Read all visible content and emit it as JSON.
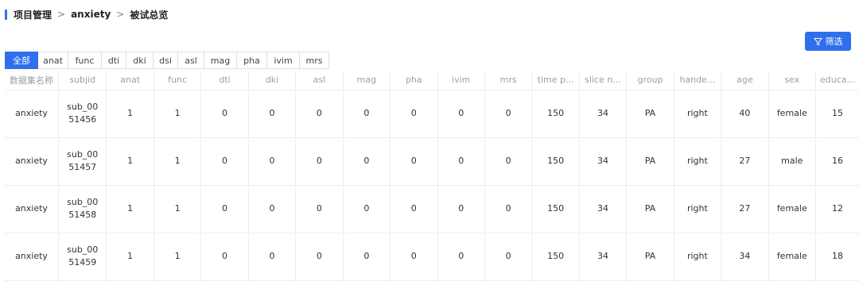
{
  "breadcrumb": {
    "items": [
      "项目管理",
      "anxiety",
      "被试总览"
    ]
  },
  "filter_button": {
    "label": "筛选",
    "icon": "filter-icon"
  },
  "tabs": [
    {
      "label": "全部",
      "active": true
    },
    {
      "label": "anat"
    },
    {
      "label": "func"
    },
    {
      "label": "dti"
    },
    {
      "label": "dki"
    },
    {
      "label": "dsi"
    },
    {
      "label": "asl"
    },
    {
      "label": "mag"
    },
    {
      "label": "pha"
    },
    {
      "label": "ivim"
    },
    {
      "label": "mrs"
    }
  ],
  "table": {
    "headers": [
      "数据集名称",
      "subjid",
      "anat",
      "func",
      "dti",
      "dki",
      "asl",
      "mag",
      "pha",
      "ivim",
      "mrs",
      "time p...",
      "slice n...",
      "group",
      "hande...",
      "age",
      "sex",
      "educa..."
    ],
    "rows": [
      [
        "anxiety",
        "sub_0051456",
        "1",
        "1",
        "0",
        "0",
        "0",
        "0",
        "0",
        "0",
        "0",
        "150",
        "34",
        "PA",
        "right",
        "40",
        "female",
        "15"
      ],
      [
        "anxiety",
        "sub_0051457",
        "1",
        "1",
        "0",
        "0",
        "0",
        "0",
        "0",
        "0",
        "0",
        "150",
        "34",
        "PA",
        "right",
        "27",
        "male",
        "16"
      ],
      [
        "anxiety",
        "sub_0051458",
        "1",
        "1",
        "0",
        "0",
        "0",
        "0",
        "0",
        "0",
        "0",
        "150",
        "34",
        "PA",
        "right",
        "27",
        "female",
        "12"
      ],
      [
        "anxiety",
        "sub_0051459",
        "1",
        "1",
        "0",
        "0",
        "0",
        "0",
        "0",
        "0",
        "0",
        "150",
        "34",
        "PA",
        "right",
        "34",
        "female",
        "18"
      ]
    ]
  },
  "colors": {
    "accent": "#2f6fed"
  }
}
